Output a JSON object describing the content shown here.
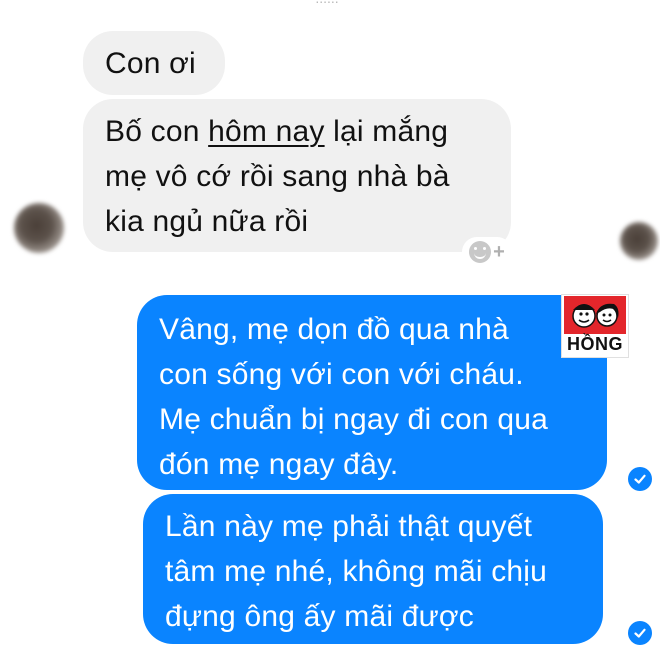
{
  "top_fragment": "......",
  "messages": [
    {
      "direction": "incoming",
      "lines": [
        "Con ơi"
      ]
    },
    {
      "direction": "incoming",
      "lines": [
        "Bố con ",
        "hôm nay",
        " lại mắng",
        "mẹ vô cớ rồi sang nhà bà",
        "kia ngủ nữa rồi"
      ]
    },
    {
      "direction": "outgoing",
      "lines": [
        "Vâng, mẹ dọn đồ qua nhà",
        "con sống với con với cháu.",
        "Mẹ chuẩn bị ngay đi con qua",
        "đón mẹ ngay đây."
      ]
    },
    {
      "direction": "outgoing",
      "lines": [
        "Lần này mẹ phải thật quyết",
        "tâm mẹ nhé, không mãi chịu",
        "đựng ông ấy mãi được"
      ]
    }
  ],
  "icons": {
    "reaction": "add-reaction-icon",
    "seen": "seen-check-icon",
    "sender_avatar": "avatar",
    "watermark": "hong-logo"
  },
  "watermark_text": "HỒNG",
  "colors": {
    "incoming_bubble": "#f0f0f0",
    "outgoing_bubble": "#0a84ff",
    "incoming_text": "#111111",
    "outgoing_text": "#ffffff"
  }
}
